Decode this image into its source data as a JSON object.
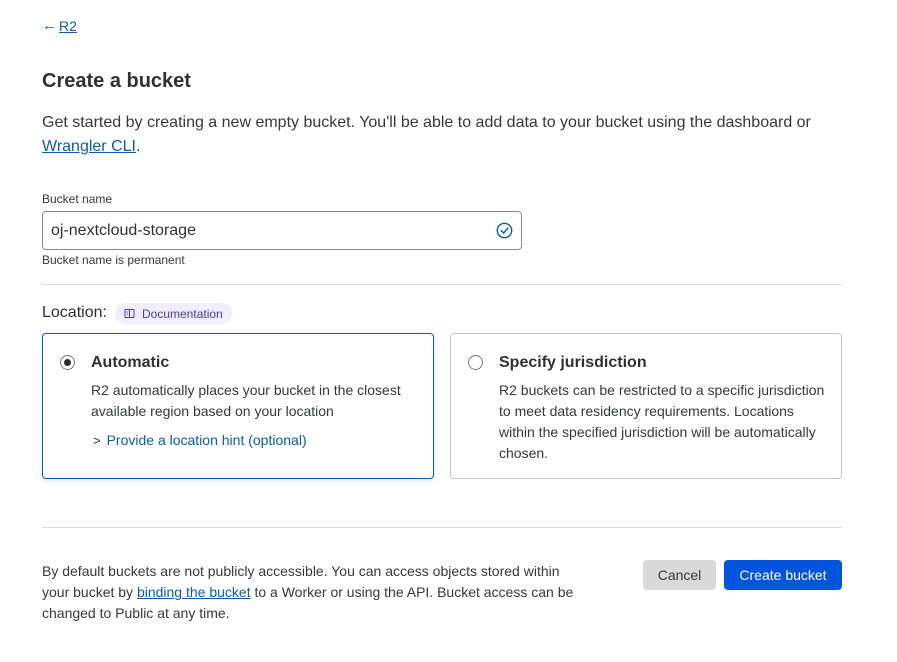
{
  "breadcrumb": {
    "back_arrow": "←",
    "back_label": "R2"
  },
  "page": {
    "title": "Create a bucket",
    "intro_text": "Get started by creating a new empty bucket. You'll be able to add data to your bucket using the dashboard or ",
    "intro_link": "Wrangler CLI",
    "intro_end": "."
  },
  "bucket_field": {
    "label": "Bucket name",
    "value": "oj-nextcloud-storage",
    "hint": "Bucket name is permanent",
    "valid_icon": "check-circle-icon"
  },
  "location": {
    "label": "Location:",
    "doc_pill": "Documentation",
    "doc_icon": "book-icon",
    "options": [
      {
        "title": "Automatic",
        "description": "R2 automatically places your bucket in the closest available region based on your location",
        "hint_chevron": ">",
        "hint_link": "Provide a location hint (optional)",
        "selected": true
      },
      {
        "title": "Specify jurisdiction",
        "description": "R2 buckets can be restricted to a specific jurisdiction to meet data residency requirements. Locations within the specified jurisdiction will be automatically chosen.",
        "selected": false
      }
    ]
  },
  "footer": {
    "text_before": "By default buckets are not publicly accessible. You can access objects stored within your bucket by ",
    "link": "binding the bucket",
    "text_after": " to a Worker or using the API. Bucket access can be changed to Public at any time.",
    "cancel_label": "Cancel",
    "create_label": "Create bucket"
  },
  "colors": {
    "link": "#0b5cad",
    "primary_button": "#0055dc",
    "selected_border": "#0b5cad",
    "doc_pill_bg": "#f1eefc",
    "doc_pill_text": "#4f38b4"
  }
}
